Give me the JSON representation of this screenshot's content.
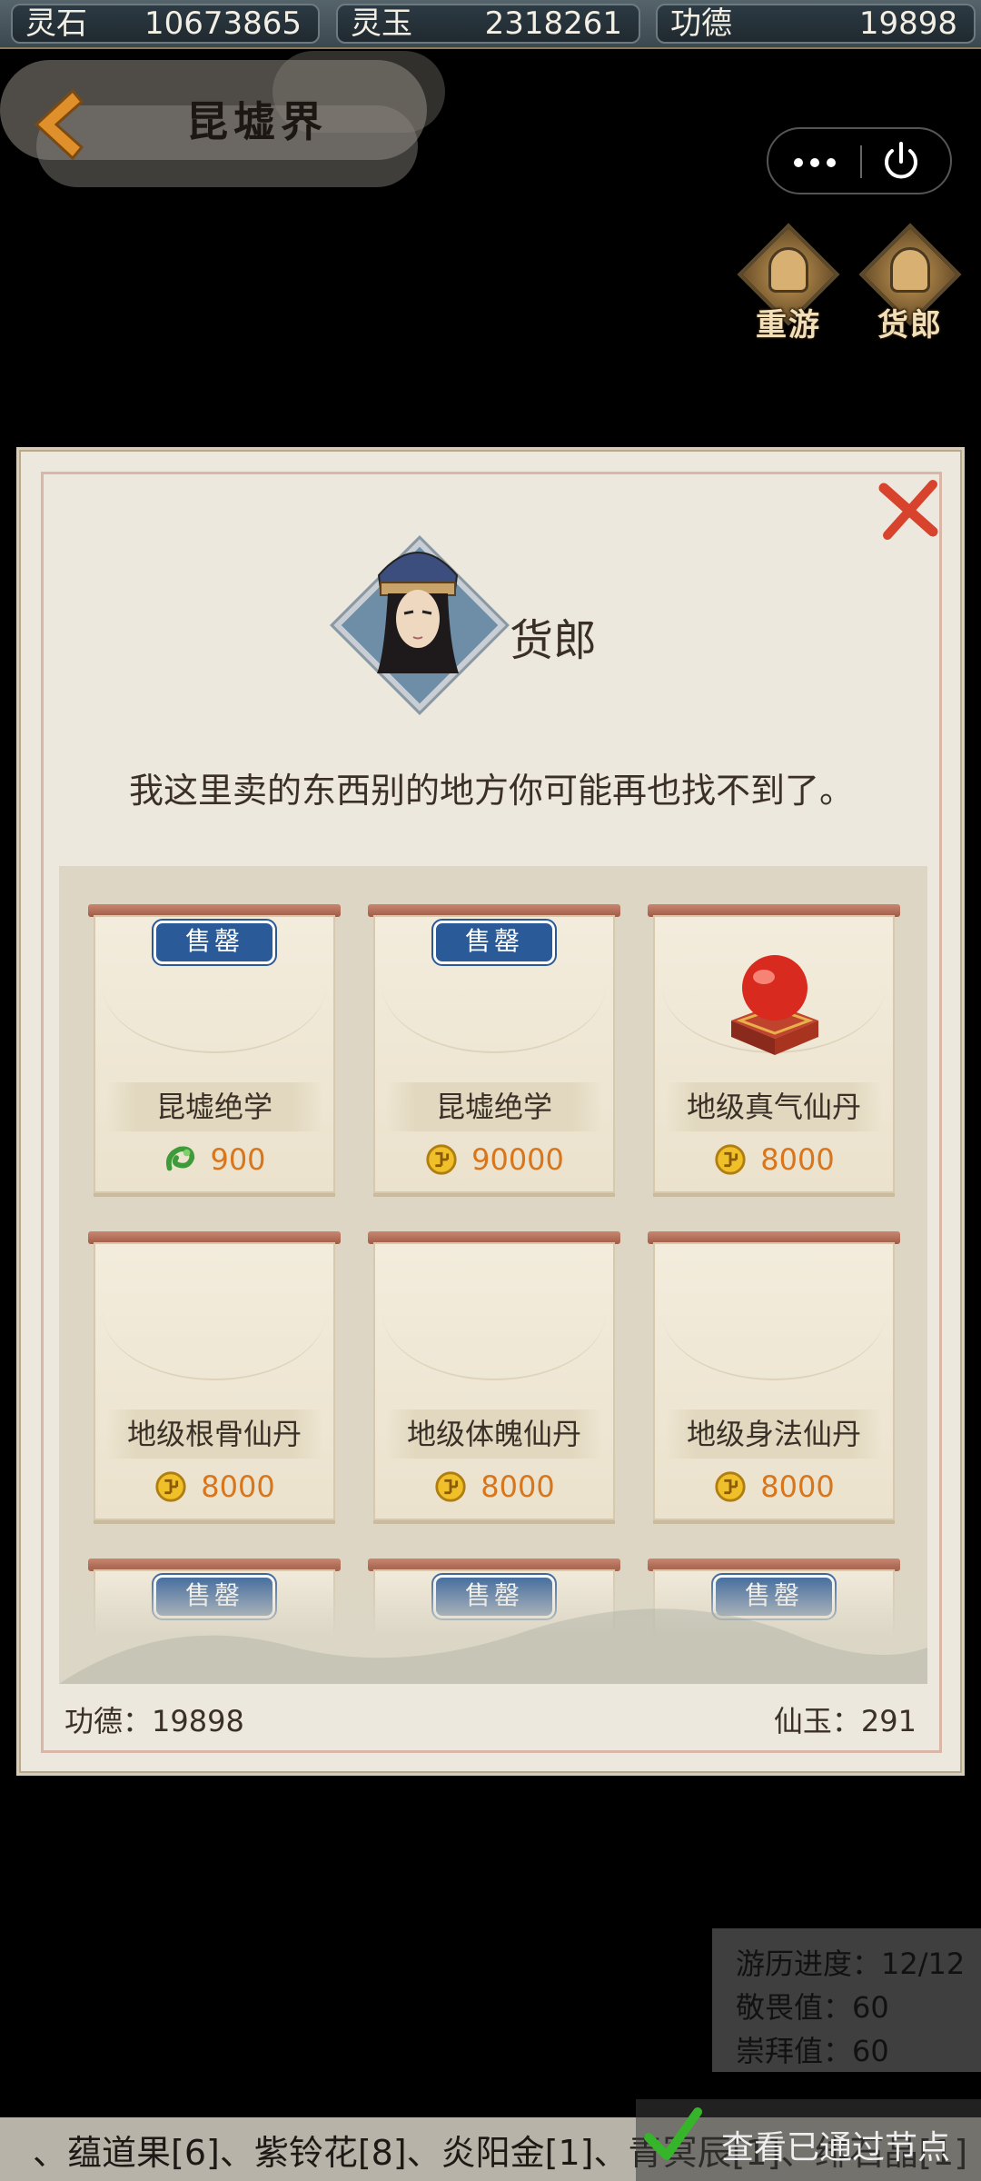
{
  "currencies": [
    {
      "label": "灵石",
      "value": "10673865"
    },
    {
      "label": "灵玉",
      "value": "2318261"
    },
    {
      "label": "功德",
      "value": "19898"
    }
  ],
  "header": {
    "title": "昆墟界"
  },
  "side_buttons": [
    {
      "label": "重游",
      "icon": "temple-icon"
    },
    {
      "label": "货郎",
      "icon": "merchant-icon"
    }
  ],
  "dialog": {
    "npc_name": "货郎",
    "npc_line": "我这里卖的东西别的地方你可能再也找不到了。",
    "sold_out_label": "售罄",
    "items": [
      {
        "name": "昆墟绝学",
        "price": "900",
        "currency": "jade-dragon-icon",
        "sold_out": true
      },
      {
        "name": "昆墟绝学",
        "price": "90000",
        "currency": "gold-coin-icon",
        "sold_out": true
      },
      {
        "name": "地级真气仙丹",
        "price": "8000",
        "currency": "gold-coin-icon",
        "sold_out": false,
        "icon": "red-pill-icon"
      },
      {
        "name": "地级根骨仙丹",
        "price": "8000",
        "currency": "gold-coin-icon",
        "sold_out": false
      },
      {
        "name": "地级体魄仙丹",
        "price": "8000",
        "currency": "gold-coin-icon",
        "sold_out": false
      },
      {
        "name": "地级身法仙丹",
        "price": "8000",
        "currency": "gold-coin-icon",
        "sold_out": false
      },
      {
        "sold_out": true
      },
      {
        "sold_out": true
      },
      {
        "sold_out": true
      }
    ],
    "footer": {
      "merit": "功德：19898",
      "xianyu": "仙玉：291"
    }
  },
  "progress": {
    "line1": "游历进度：12/12",
    "line2": "敬畏值：60",
    "line3": "崇拜值：60"
  },
  "ticker": {
    "text": "、蕴道果[6]、紫铃花[8]、炎阳金[1]、青冥辰[1]、绯石晶[1]"
  },
  "passed_nodes": {
    "label": "查看已通过节点"
  },
  "colors": {
    "price": "#d9761c",
    "sold_out_tag": "#2a5a98",
    "close": "#d8432e"
  }
}
